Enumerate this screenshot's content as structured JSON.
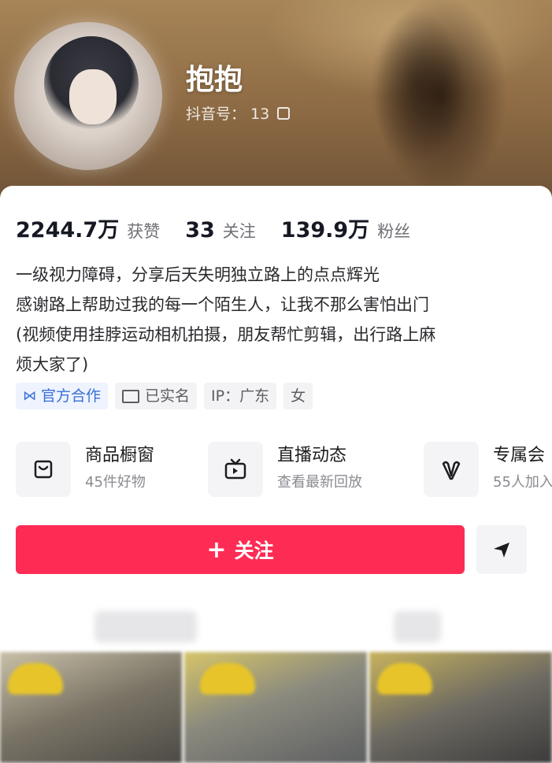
{
  "profile": {
    "display_name": "抱抱",
    "account_id": "抖音号：           13"
  },
  "stats": [
    {
      "value": "2244.7万",
      "label": "获赞"
    },
    {
      "value": "33",
      "label": "关注"
    },
    {
      "value": "139.9万",
      "label": "粉丝"
    }
  ],
  "bio": {
    "lines": [
      "一级视力障碍，分享后天失明独立路上的点点辉光",
      "感谢路上帮助过我的每一个陌生人，让我不那么害怕出门",
      "(视频使用挂脖运动相机拍摄，朋友帮忙剪辑，出行路上麻",
      "烦大家了)"
    ]
  },
  "tags": {
    "official": "官方合作",
    "verified": "已实名",
    "ip": "IP：广东",
    "gender": "女"
  },
  "services": [
    {
      "title": "商品橱窗",
      "subtitle": "45件好物",
      "icon": "shop-window-icon"
    },
    {
      "title": "直播动态",
      "subtitle": "查看最新回放",
      "icon": "tv-icon"
    },
    {
      "title": "专属会",
      "subtitle": "55人加入",
      "icon": "heart-v-icon"
    }
  ],
  "actions": {
    "follow_label": "关注",
    "follow_plus": "+",
    "share_icon": "send-icon"
  },
  "colors": {
    "accent": "#fe2c55",
    "official_tag": "#3a6fd8"
  }
}
